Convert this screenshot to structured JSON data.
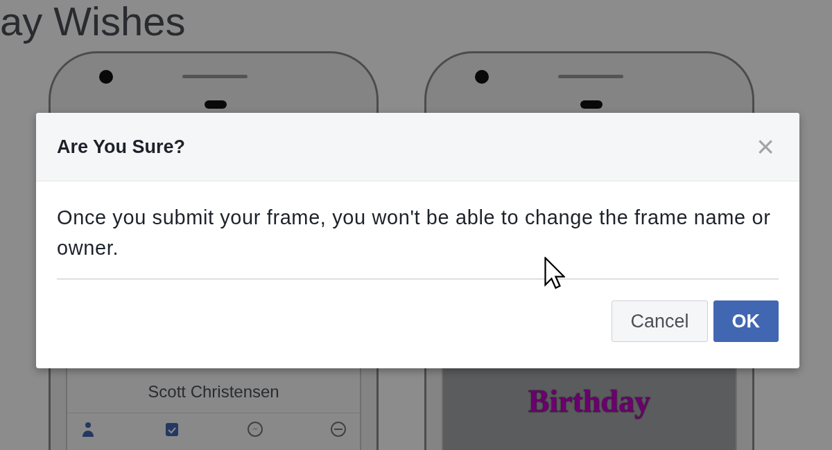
{
  "page": {
    "heading": "ay Wishes"
  },
  "phones": [
    {
      "kind": "profile",
      "name": "Scott Christensen"
    },
    {
      "kind": "frame",
      "caption": "Birthday"
    }
  ],
  "dialog": {
    "title": "Are You Sure?",
    "close": "×",
    "message": "Once you submit your frame, you won't be able to change the frame name or owner.",
    "buttons": [
      {
        "label": "Cancel",
        "kind": "secondary"
      },
      {
        "label": "OK",
        "kind": "primary"
      }
    ]
  }
}
